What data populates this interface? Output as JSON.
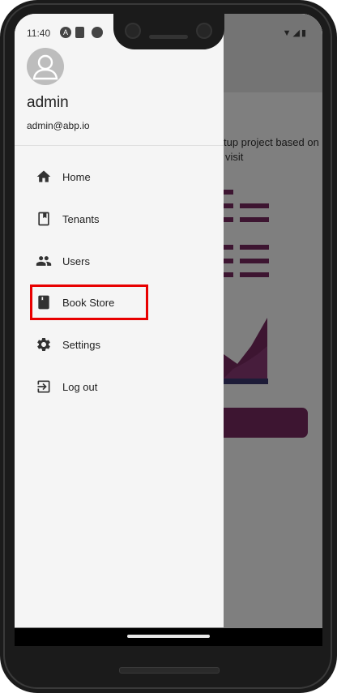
{
  "status_bar": {
    "time": "11:40",
    "left_icons": [
      "android-studio-icon",
      "sd-card-icon",
      "face-icon"
    ],
    "right_icons": [
      "wifi-icon",
      "signal-icon",
      "battery-icon"
    ]
  },
  "background_app": {
    "text_line1": "tup project based on",
    "text_line2": "visit"
  },
  "drawer": {
    "user": {
      "name": "admin",
      "email": "admin@abp.io"
    },
    "menu": [
      {
        "label": "Home",
        "icon": "home-icon"
      },
      {
        "label": "Tenants",
        "icon": "book-icon"
      },
      {
        "label": "Users",
        "icon": "people-icon"
      },
      {
        "label": "Book Store",
        "icon": "book-store-icon"
      },
      {
        "label": "Settings",
        "icon": "gear-icon"
      },
      {
        "label": "Log out",
        "icon": "logout-icon"
      }
    ]
  },
  "colors": {
    "accent": "#7a2a62",
    "highlight": "#e80000"
  }
}
